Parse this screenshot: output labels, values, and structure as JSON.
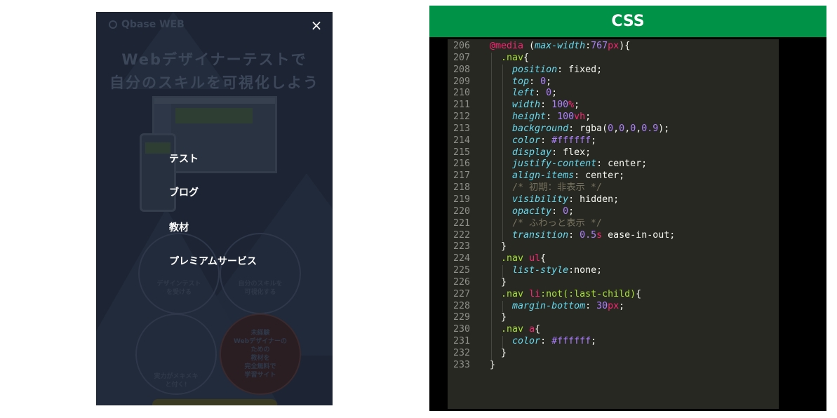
{
  "phone_preview": {
    "logo_text": "Qbase WEB",
    "hero_line1": "Webデザイナーテストで",
    "hero_line2": "自分のスキルを可視化しよう",
    "close_icon": "×",
    "nav_items": [
      {
        "label": "テスト"
      },
      {
        "label": "ブログ"
      },
      {
        "label": "教材"
      },
      {
        "label": "プレミアムサービス"
      }
    ],
    "faint_texts": [
      "デザインテスト\nを受ける",
      "自分のスキルを\n可視化する",
      "実力がメキメキ\nと付く!",
      "未経験\nWebデザイナーの\nための\n教材を\n完全無料で\n学習サイト"
    ],
    "overlay_color": "#1d2534"
  },
  "code_panel": {
    "title": "CSS",
    "header_color": "#009246",
    "lines": [
      {
        "n": "206",
        "html": "<span class=\"at\">@media</span> (<span class=\"prop\">max-width</span>:<span class=\"num\">767</span><span class=\"unit\">px</span>){"
      },
      {
        "n": "207",
        "html": "  <span class=\"sel\">.nav</span>{"
      },
      {
        "n": "208",
        "html": "    <span class=\"prop\">position</span>: fixed;"
      },
      {
        "n": "209",
        "html": "    <span class=\"prop\">top</span>: <span class=\"num\">0</span>;"
      },
      {
        "n": "210",
        "html": "    <span class=\"prop\">left</span>: <span class=\"num\">0</span>;"
      },
      {
        "n": "211",
        "html": "    <span class=\"prop\">width</span>: <span class=\"num\">100</span><span class=\"unit\">%</span>;"
      },
      {
        "n": "212",
        "html": "    <span class=\"prop\">height</span>: <span class=\"num\">100</span><span class=\"unit\">vh</span>;"
      },
      {
        "n": "213",
        "html": "    <span class=\"prop\">background</span>: rgba(<span class=\"num\">0</span>,<span class=\"num\">0</span>,<span class=\"num\">0</span>,<span class=\"num\">0.9</span>);"
      },
      {
        "n": "214",
        "html": "    <span class=\"prop\">color</span>: <span class=\"num\">#ffffff</span>;"
      },
      {
        "n": "215",
        "html": "    <span class=\"prop\">display</span>: flex;"
      },
      {
        "n": "216",
        "html": "    <span class=\"prop\">justify-content</span>: center;"
      },
      {
        "n": "217",
        "html": "    <span class=\"prop\">align-items</span>: center;"
      },
      {
        "n": "218",
        "html": "    <span class=\"cmt\">/* 初期：非表示 */</span>"
      },
      {
        "n": "219",
        "html": "    <span class=\"prop\">visibility</span>: hidden;"
      },
      {
        "n": "220",
        "html": "    <span class=\"prop\">opacity</span>: <span class=\"num\">0</span>;"
      },
      {
        "n": "221",
        "html": "    <span class=\"cmt\">/* ふわっと表示 */</span>"
      },
      {
        "n": "222",
        "html": "    <span class=\"prop\">transition</span>: <span class=\"num\">0.5</span><span class=\"unit\">s</span> ease-in-out;"
      },
      {
        "n": "223",
        "html": "  }"
      },
      {
        "n": "224",
        "html": "  <span class=\"sel\">.nav</span> <span class=\"tag\">ul</span>{"
      },
      {
        "n": "225",
        "html": "    <span class=\"prop\">list-style</span>:none;"
      },
      {
        "n": "226",
        "html": "  }"
      },
      {
        "n": "227",
        "html": "  <span class=\"sel\">.nav</span> <span class=\"tag\">li</span><span class=\"sel\">:not(:last-child)</span>{"
      },
      {
        "n": "228",
        "html": "    <span class=\"prop\">margin-bottom</span>: <span class=\"num\">30</span><span class=\"unit\">px</span>;"
      },
      {
        "n": "229",
        "html": "  }"
      },
      {
        "n": "230",
        "html": "  <span class=\"sel\">.nav</span> <span class=\"tag\">a</span>{"
      },
      {
        "n": "231",
        "html": "    <span class=\"prop\">color</span>: <span class=\"num\">#ffffff</span>;"
      },
      {
        "n": "232",
        "html": "  }"
      },
      {
        "n": "233",
        "html": "}"
      }
    ]
  }
}
